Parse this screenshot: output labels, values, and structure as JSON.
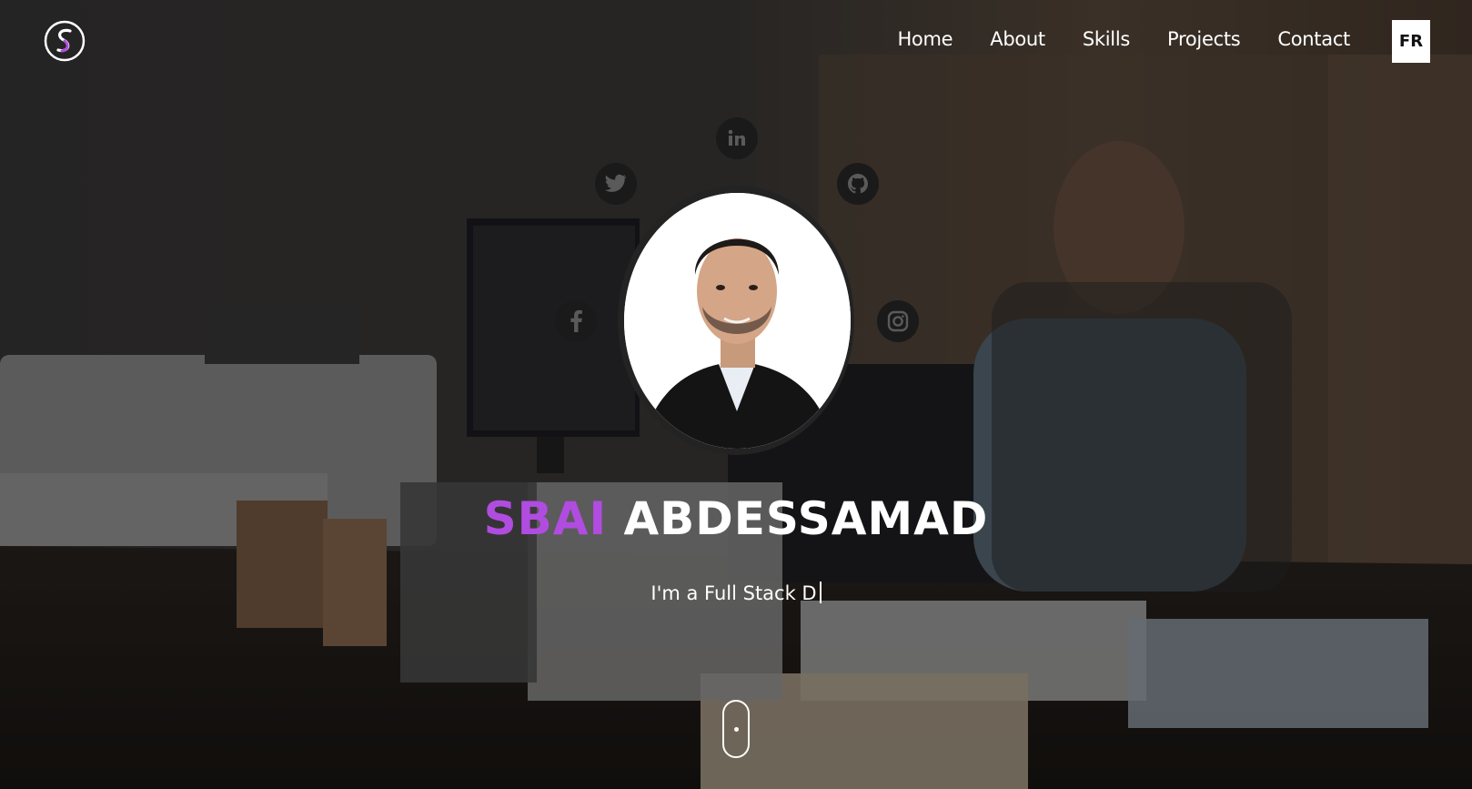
{
  "nav": {
    "logo_letter": "S",
    "items": [
      {
        "label": "Home"
      },
      {
        "label": "About"
      },
      {
        "label": "Skills"
      },
      {
        "label": "Projects"
      },
      {
        "label": "Contact"
      }
    ],
    "lang_button": "FR"
  },
  "social": {
    "linkedin_icon": "linkedin-icon",
    "twitter_icon": "twitter-icon",
    "github_icon": "github-icon",
    "facebook_icon": "facebook-icon",
    "instagram_icon": "instagram-icon"
  },
  "hero": {
    "first_name": "SBAI",
    "last_name": "ABDESSAMAD",
    "tagline": "I'm a Full Stack D"
  },
  "colors": {
    "accent": "#b14ce0",
    "text": "#ffffff"
  }
}
